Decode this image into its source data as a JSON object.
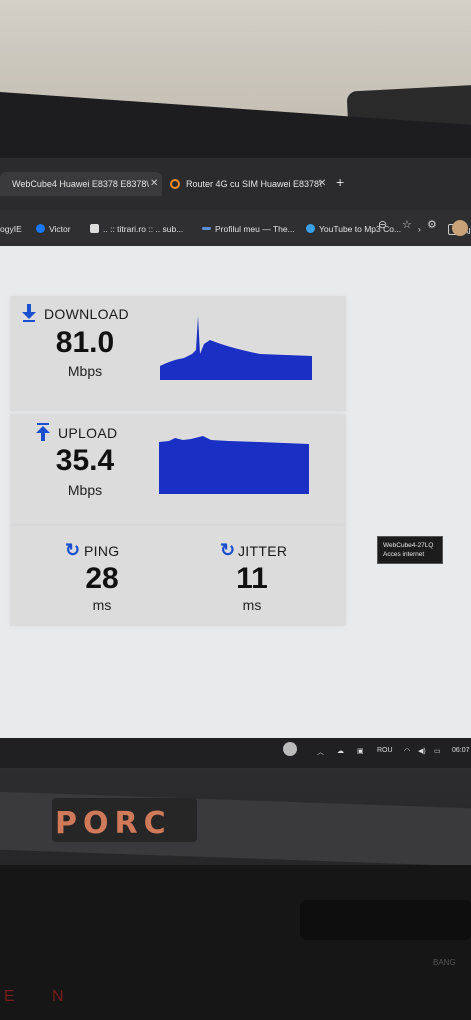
{
  "browser": {
    "tabs": [
      {
        "label": "WebCube4 Huawei E8378 E8378\\"
      },
      {
        "label": "Router 4G cu SIM Huawei E8378\\"
      }
    ],
    "new_tab_symbol": "+",
    "bookmarks": [
      {
        "label": "ogyIE"
      },
      {
        "label": "Victor"
      },
      {
        "label": ".. :: titrari.ro :: .. sub..."
      },
      {
        "label": "Profilul meu — The..."
      },
      {
        "label": "YouTube to Mp3 Co..."
      },
      {
        "label": "Alt"
      }
    ]
  },
  "speedtest": {
    "download": {
      "label": "DOWNLOAD",
      "value": "81.0",
      "unit": "Mbps"
    },
    "upload": {
      "label": "UPLOAD",
      "value": "35.4",
      "unit": "Mbps"
    },
    "ping": {
      "label": "PING",
      "value": "28",
      "unit": "ms"
    },
    "jitter": {
      "label": "JITTER",
      "value": "11",
      "unit": "ms"
    },
    "graph_color": "#1a2fc4",
    "accent_color": "#1a4fd0"
  },
  "tooltip": {
    "line1": "WebCube4-27LQ",
    "line2": "Acces internet"
  },
  "taskbar": {
    "language": "ROU",
    "time": "06:07"
  },
  "laptop": {
    "logo": "PORC",
    "letters": [
      "E",
      "N"
    ],
    "brand_small": "BANG"
  }
}
